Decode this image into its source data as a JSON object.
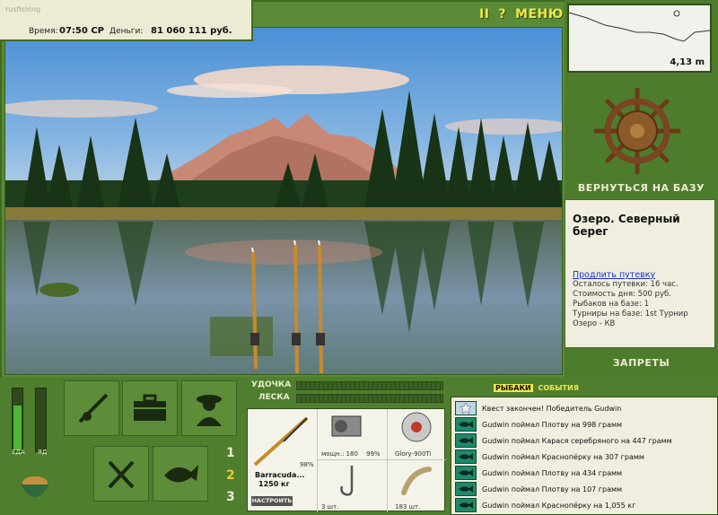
{
  "status": {
    "time_label": "Время:",
    "time_value": "07:50 СР",
    "money_label": "Деньги:",
    "money_value": "81 060 111 руб."
  },
  "menu": {
    "pause": "II",
    "help": "?",
    "menu": "МЕНЮ"
  },
  "depth": {
    "value": "4,13 m"
  },
  "base": {
    "return_label": "ВЕРНУТЬСЯ НА БАЗУ",
    "location": "Озеро. Северный берег",
    "extend_link": "Продлить путевку",
    "lines": [
      "Осталось путевки: 16 час.",
      "Стоимость дня: 500 руб.",
      "Рыбаков на базе: 1",
      "Турниры на базе: 1st Турнир Озеро - КВ"
    ],
    "bans_label": "ЗАПРЕТЫ"
  },
  "needs": {
    "food_label": "ЕДА",
    "food_level": 0.72,
    "poison_label": "ЯД",
    "poison_level": 0.0
  },
  "slots": [
    "1",
    "2",
    "3"
  ],
  "active_slot": "2",
  "tackle": {
    "rod_label": "УДОЧКА",
    "line_label": "ЛЕСКА",
    "rod_name": "Barracuda...",
    "rod_weight": "1250 кг",
    "rod_condition": "98%",
    "reel_power": "мощн.: 180",
    "reel_condition": "99%",
    "line_name": "Glory-900Ti",
    "hooks_count": "3 шт.",
    "bait_count": "183 шт.",
    "tune_label": "НАСТРОИТЬ"
  },
  "feed": {
    "tab_fishers": "РЫБАКИ",
    "tab_events": "СОБЫТИЯ",
    "items": [
      {
        "icon": "star-icon",
        "text": "Квест закончен! Победитель Gudwin"
      },
      {
        "icon": "fish-icon",
        "text": "Gudwin поймал Плотву на 998 грамм"
      },
      {
        "icon": "fish-icon",
        "text": "Gudwin поймал Карася серебряного на 447 грамм"
      },
      {
        "icon": "fish-icon",
        "text": "Gudwin поймал Краснопёрку на 307 грамм"
      },
      {
        "icon": "fish-icon",
        "text": "Gudwin поймал Плотву на 434 грамм"
      },
      {
        "icon": "fish-icon",
        "text": "Gudwin поймал Плотву на 107 грамм"
      },
      {
        "icon": "fish-icon",
        "text": "Gudwin поймал Краснопёрку на 1,055 кг"
      }
    ]
  }
}
